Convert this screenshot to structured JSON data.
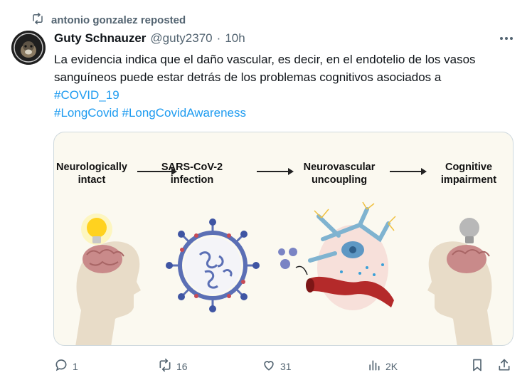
{
  "repost": {
    "text": "antonio gonzalez reposted"
  },
  "author": {
    "display_name": "Guty Schnauzer",
    "handle": "@guty2370",
    "separator": "·",
    "time": "10h"
  },
  "tweet": {
    "line1": "La evidencia indica que el daño vascular, es decir, en el endotelio de los vasos",
    "line2": "sanguíneos puede estar detrás de los problemas cognitivos asociados a",
    "hashtag1": "#COVID_19",
    "hashtag2": "#LongCovid",
    "hashtag3": "#LongCovidAwareness"
  },
  "media": {
    "step1_line1": "Neurologically",
    "step1_line2": "intact",
    "step2_line1": "SARS-CoV-2",
    "step2_line2": "infection",
    "step3_line1": "Neurovascular",
    "step3_line2": "uncoupling",
    "step4_line1": "Cognitive",
    "step4_line2": "impairment"
  },
  "actions": {
    "replies": "1",
    "reposts": "16",
    "likes": "31",
    "views": "2K"
  },
  "colors": {
    "accent": "#1d9bf0",
    "secondary_text": "#536471",
    "border": "#cfd9de"
  },
  "icons": [
    "repost-icon",
    "more-icon",
    "reply-icon",
    "retweet-icon",
    "like-icon",
    "views-icon",
    "bookmark-icon",
    "share-icon"
  ]
}
